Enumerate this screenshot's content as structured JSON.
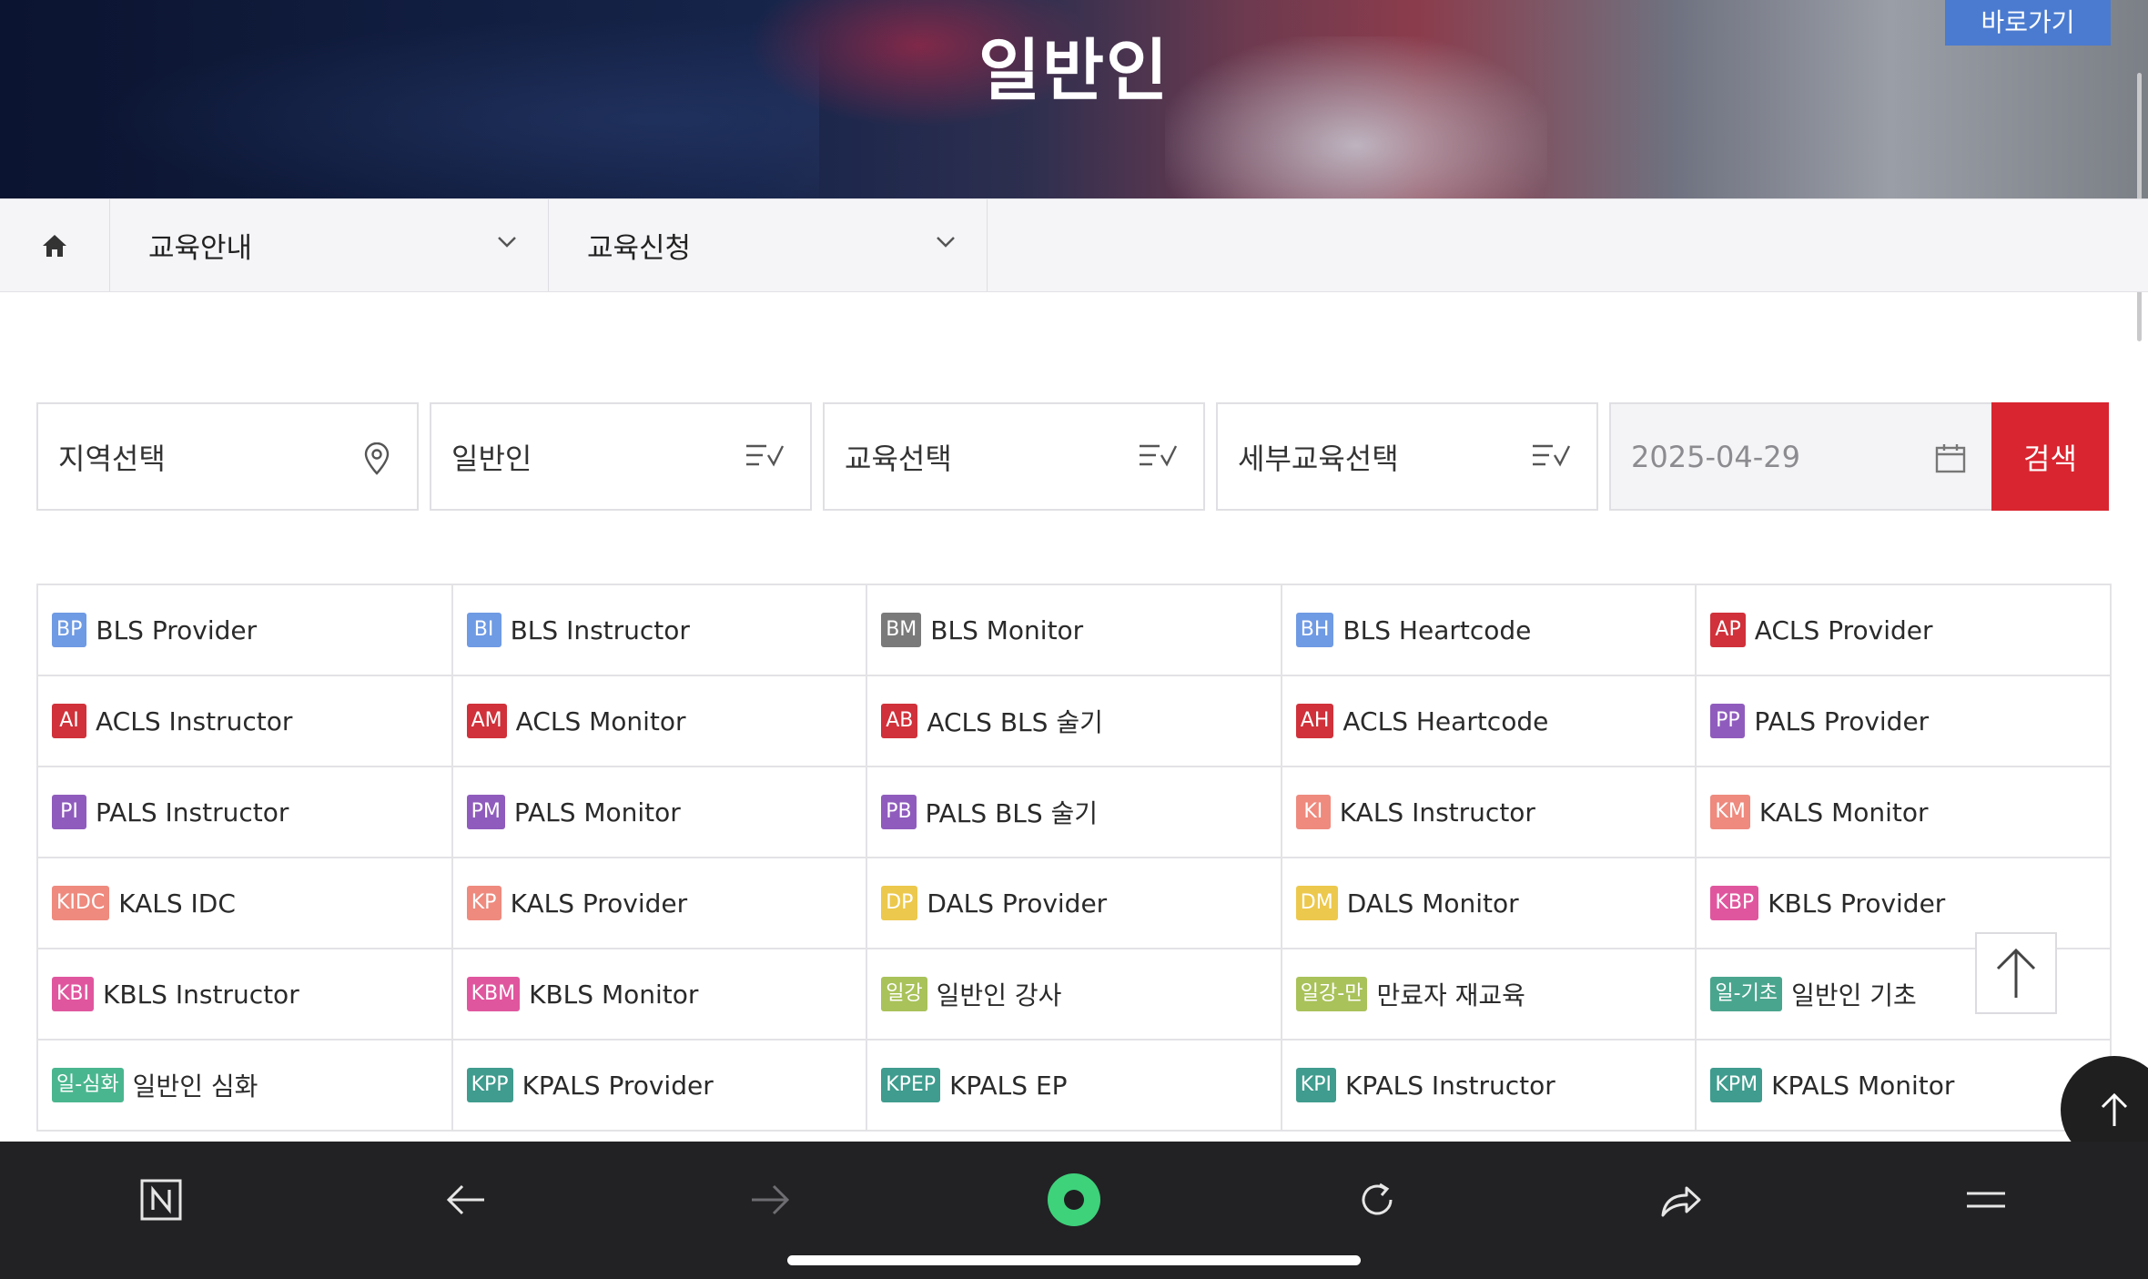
{
  "hero": {
    "title": "일반인",
    "shortcut_label": "바로가기"
  },
  "breadcrumb": {
    "home_icon": "home-icon",
    "dropdowns": [
      {
        "label": "교육안내"
      },
      {
        "label": "교육신청"
      }
    ]
  },
  "filters": {
    "region": {
      "label": "지역선택",
      "icon": "location-pin-icon"
    },
    "category": {
      "label": "일반인",
      "icon": "checklist-icon"
    },
    "course": {
      "label": "교육선택",
      "icon": "checklist-icon"
    },
    "detail": {
      "label": "세부교육선택",
      "icon": "checklist-icon"
    },
    "date": {
      "value": "2025-04-29",
      "icon": "calendar-icon"
    },
    "search_label": "검색"
  },
  "courses": [
    {
      "badge": "BP",
      "label": "BLS Provider",
      "color": "#6f9ae4"
    },
    {
      "badge": "BI",
      "label": "BLS Instructor",
      "color": "#6f9ae4"
    },
    {
      "badge": "BM",
      "label": "BLS Monitor",
      "color": "#7a7a7a"
    },
    {
      "badge": "BH",
      "label": "BLS Heartcode",
      "color": "#6f9ae4"
    },
    {
      "badge": "AP",
      "label": "ACLS Provider",
      "color": "#d0313a"
    },
    {
      "badge": "AI",
      "label": "ACLS Instructor",
      "color": "#d0313a"
    },
    {
      "badge": "AM",
      "label": "ACLS Monitor",
      "color": "#d0313a"
    },
    {
      "badge": "AB",
      "label": "ACLS BLS 술기",
      "color": "#d0313a"
    },
    {
      "badge": "AH",
      "label": "ACLS Heartcode",
      "color": "#d0313a"
    },
    {
      "badge": "PP",
      "label": "PALS Provider",
      "color": "#8f5cbd"
    },
    {
      "badge": "PI",
      "label": "PALS Instructor",
      "color": "#8f5cbd"
    },
    {
      "badge": "PM",
      "label": "PALS Monitor",
      "color": "#8f5cbd"
    },
    {
      "badge": "PB",
      "label": "PALS BLS 술기",
      "color": "#8f5cbd"
    },
    {
      "badge": "KI",
      "label": "KALS Instructor",
      "color": "#ee8a7e"
    },
    {
      "badge": "KM",
      "label": "KALS Monitor",
      "color": "#ee8a7e"
    },
    {
      "badge": "KIDC",
      "label": "KALS IDC",
      "color": "#ee8a7e"
    },
    {
      "badge": "KP",
      "label": "KALS Provider",
      "color": "#ee8a7e"
    },
    {
      "badge": "DP",
      "label": "DALS Provider",
      "color": "#ecc84d"
    },
    {
      "badge": "DM",
      "label": "DALS Monitor",
      "color": "#ecc84d"
    },
    {
      "badge": "KBP",
      "label": "KBLS Provider",
      "color": "#e0569e"
    },
    {
      "badge": "KBI",
      "label": "KBLS Instructor",
      "color": "#e0569e"
    },
    {
      "badge": "KBM",
      "label": "KBLS Monitor",
      "color": "#e0569e"
    },
    {
      "badge": "일강",
      "label": "일반인 강사",
      "color": "#a9c25a"
    },
    {
      "badge": "일강-만",
      "label": "만료자 재교육",
      "color": "#a9c25a"
    },
    {
      "badge": "일-기초",
      "label": "일반인 기초",
      "color": "#4aa58e"
    },
    {
      "badge": "일-심화",
      "label": "일반인 심화",
      "color": "#4ab68f"
    },
    {
      "badge": "KPP",
      "label": "KPALS Provider",
      "color": "#3f9c8e"
    },
    {
      "badge": "KPEP",
      "label": "KPALS EP",
      "color": "#3f9c8e"
    },
    {
      "badge": "KPI",
      "label": "KPALS Instructor",
      "color": "#3f9c8e"
    },
    {
      "badge": "KPM",
      "label": "KPALS Monitor",
      "color": "#3f9c8e"
    }
  ],
  "floating": {
    "to_top_icon": "arrow-up-icon"
  },
  "browser_bar": {
    "buttons": [
      "naver-icon",
      "back-arrow-icon",
      "forward-arrow-icon",
      "green-dot-icon",
      "refresh-icon",
      "share-icon",
      "menu-icon"
    ]
  }
}
